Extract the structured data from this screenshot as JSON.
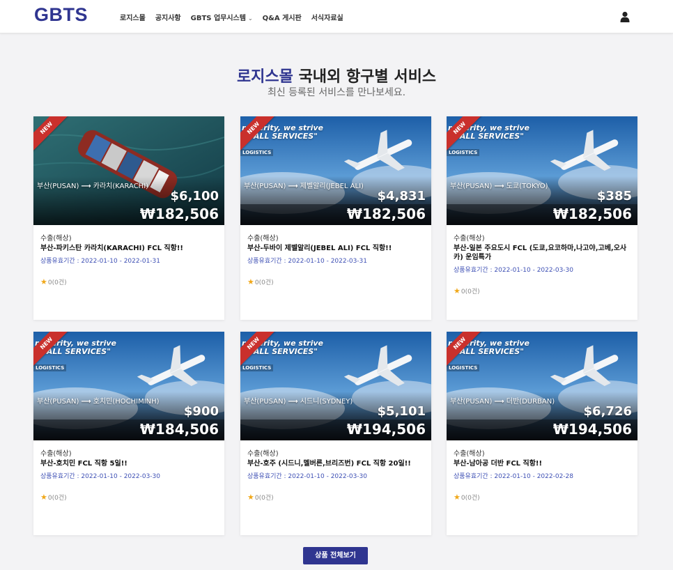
{
  "header": {
    "logo": "GBTS",
    "nav": [
      "로지스몰",
      "공지사항",
      "GBTS 업무시스템",
      "Q&A 게시판",
      "서식자료실"
    ],
    "user_icon": "user-icon"
  },
  "hero": {
    "title_accent": "로지스몰",
    "title_rest": " 국내외 항구별 서비스",
    "subtitle": "최신 등록된 서비스를 만나보세요."
  },
  "thumb_text": {
    "ribbon": "NEW",
    "slogan1": "r  sperity, we strive",
    "slogan2": "L ALL SERVICES\"",
    "logistics": "LOGISTICS"
  },
  "cards": [
    {
      "image": "ship",
      "origin": "부산(PUSAN)",
      "dest": "카라치(KARACHI)",
      "usd": "$6,100",
      "krw": "₩182,506",
      "category": "수출(해상)",
      "title": "부산-파키스탄 카라치(KARACHI) FCL 직항!!",
      "validity": "상품유효기간 : 2022-01-10 - 2022-01-31",
      "rating": "0(0건)"
    },
    {
      "image": "plane",
      "origin": "부산(PUSAN)",
      "dest": "제벨알리(JEBEL ALI)",
      "usd": "$4,831",
      "krw": "₩182,506",
      "category": "수출(해상)",
      "title": "부산-두바이 제벨알리(JEBEL ALI) FCL 직항!!",
      "validity": "상품유효기간 : 2022-01-10 - 2022-03-31",
      "rating": "0(0건)"
    },
    {
      "image": "plane",
      "origin": "부산(PUSAN)",
      "dest": "도쿄(TOKYO)",
      "usd": "$385",
      "krw": "₩182,506",
      "category": "수출(해상)",
      "title": "부산-일본 주요도시 FCL (도쿄,요코하마,나고야,고베,오사카) 운임특가",
      "validity": "상품유효기간 : 2022-01-10 - 2022-03-30",
      "rating": "0(0건)"
    },
    {
      "image": "plane",
      "origin": "부산(PUSAN)",
      "dest": "호치민(HOCHIMINH)",
      "usd": "$900",
      "krw": "₩184,506",
      "category": "수출(해상)",
      "title": "부산-호치민 FCL 직항 5일!!",
      "validity": "상품유효기간 : 2022-01-10 - 2022-03-30",
      "rating": "0(0건)"
    },
    {
      "image": "plane",
      "origin": "부산(PUSAN)",
      "dest": "시드니(SYDNEY)",
      "usd": "$5,101",
      "krw": "₩194,506",
      "category": "수출(해상)",
      "title": "부산-호주 (시드니,멜버른,브리즈번) FCL 직항 20일!!",
      "validity": "상품유효기간 : 2022-01-10 - 2022-03-30",
      "rating": "0(0건)"
    },
    {
      "image": "plane",
      "origin": "부산(PUSAN)",
      "dest": "더반(DURBAN)",
      "usd": "$6,726",
      "krw": "₩194,506",
      "category": "수출(해상)",
      "title": "부산-남아공 더반 FCL 직항!!",
      "validity": "상품유효기간 : 2022-01-10 - 2022-02-28",
      "rating": "0(0건)"
    }
  ],
  "view_all_label": "상품 전체보기",
  "colors": {
    "brand": "#2f3590",
    "ribbon": "#c9302c",
    "star": "#f0a81a",
    "validity": "#3f51b5"
  }
}
